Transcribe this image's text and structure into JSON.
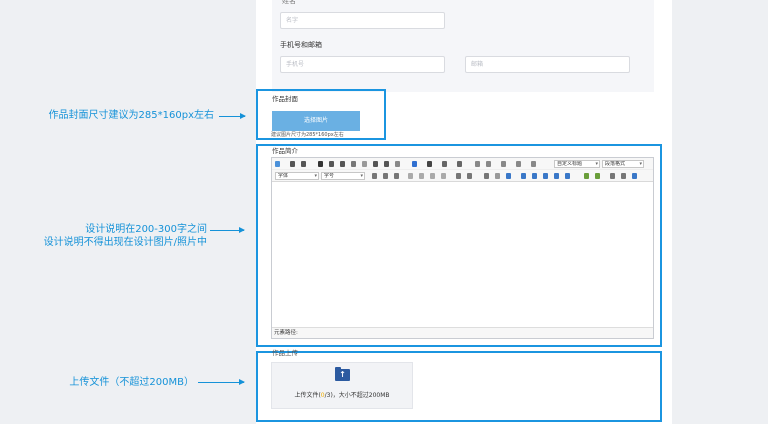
{
  "form": {
    "top_label_partial": "姓名",
    "name_placeholder": "名字",
    "contact_label": "手机号和邮箱",
    "phone_placeholder": "手机号",
    "email_placeholder": "邮箱",
    "cover_label": "作品封面",
    "upload_cover_button": "选择图片",
    "cover_hint": "建议图片尺寸为285*160px左右",
    "intro_label": "作品简介",
    "upload_label": "作品上传"
  },
  "editor": {
    "custom_title_select": "自定义标题",
    "paragraph_select": "段落格式",
    "font_select": "字体",
    "size_select": "字号",
    "status_path": "元素路径:"
  },
  "file_upload": {
    "text_before": "上传文件(",
    "count_current": "0",
    "text_after": "/3)，大小不超过200MB"
  },
  "annotations": {
    "cover": "作品封面尺寸建议为285*160px左右",
    "intro_line1": "设计说明在200-300字之间",
    "intro_line2": "设计说明不得出现在设计图片/照片中",
    "upload": "上传文件（不超过200MB）"
  },
  "colors": {
    "annotation_blue": "#1592d8",
    "highlight_box": "#1b95e0",
    "upload_button": "#6ab0e3",
    "folder_icon": "#2c5aa0",
    "count_highlight": "#f0ad00"
  }
}
